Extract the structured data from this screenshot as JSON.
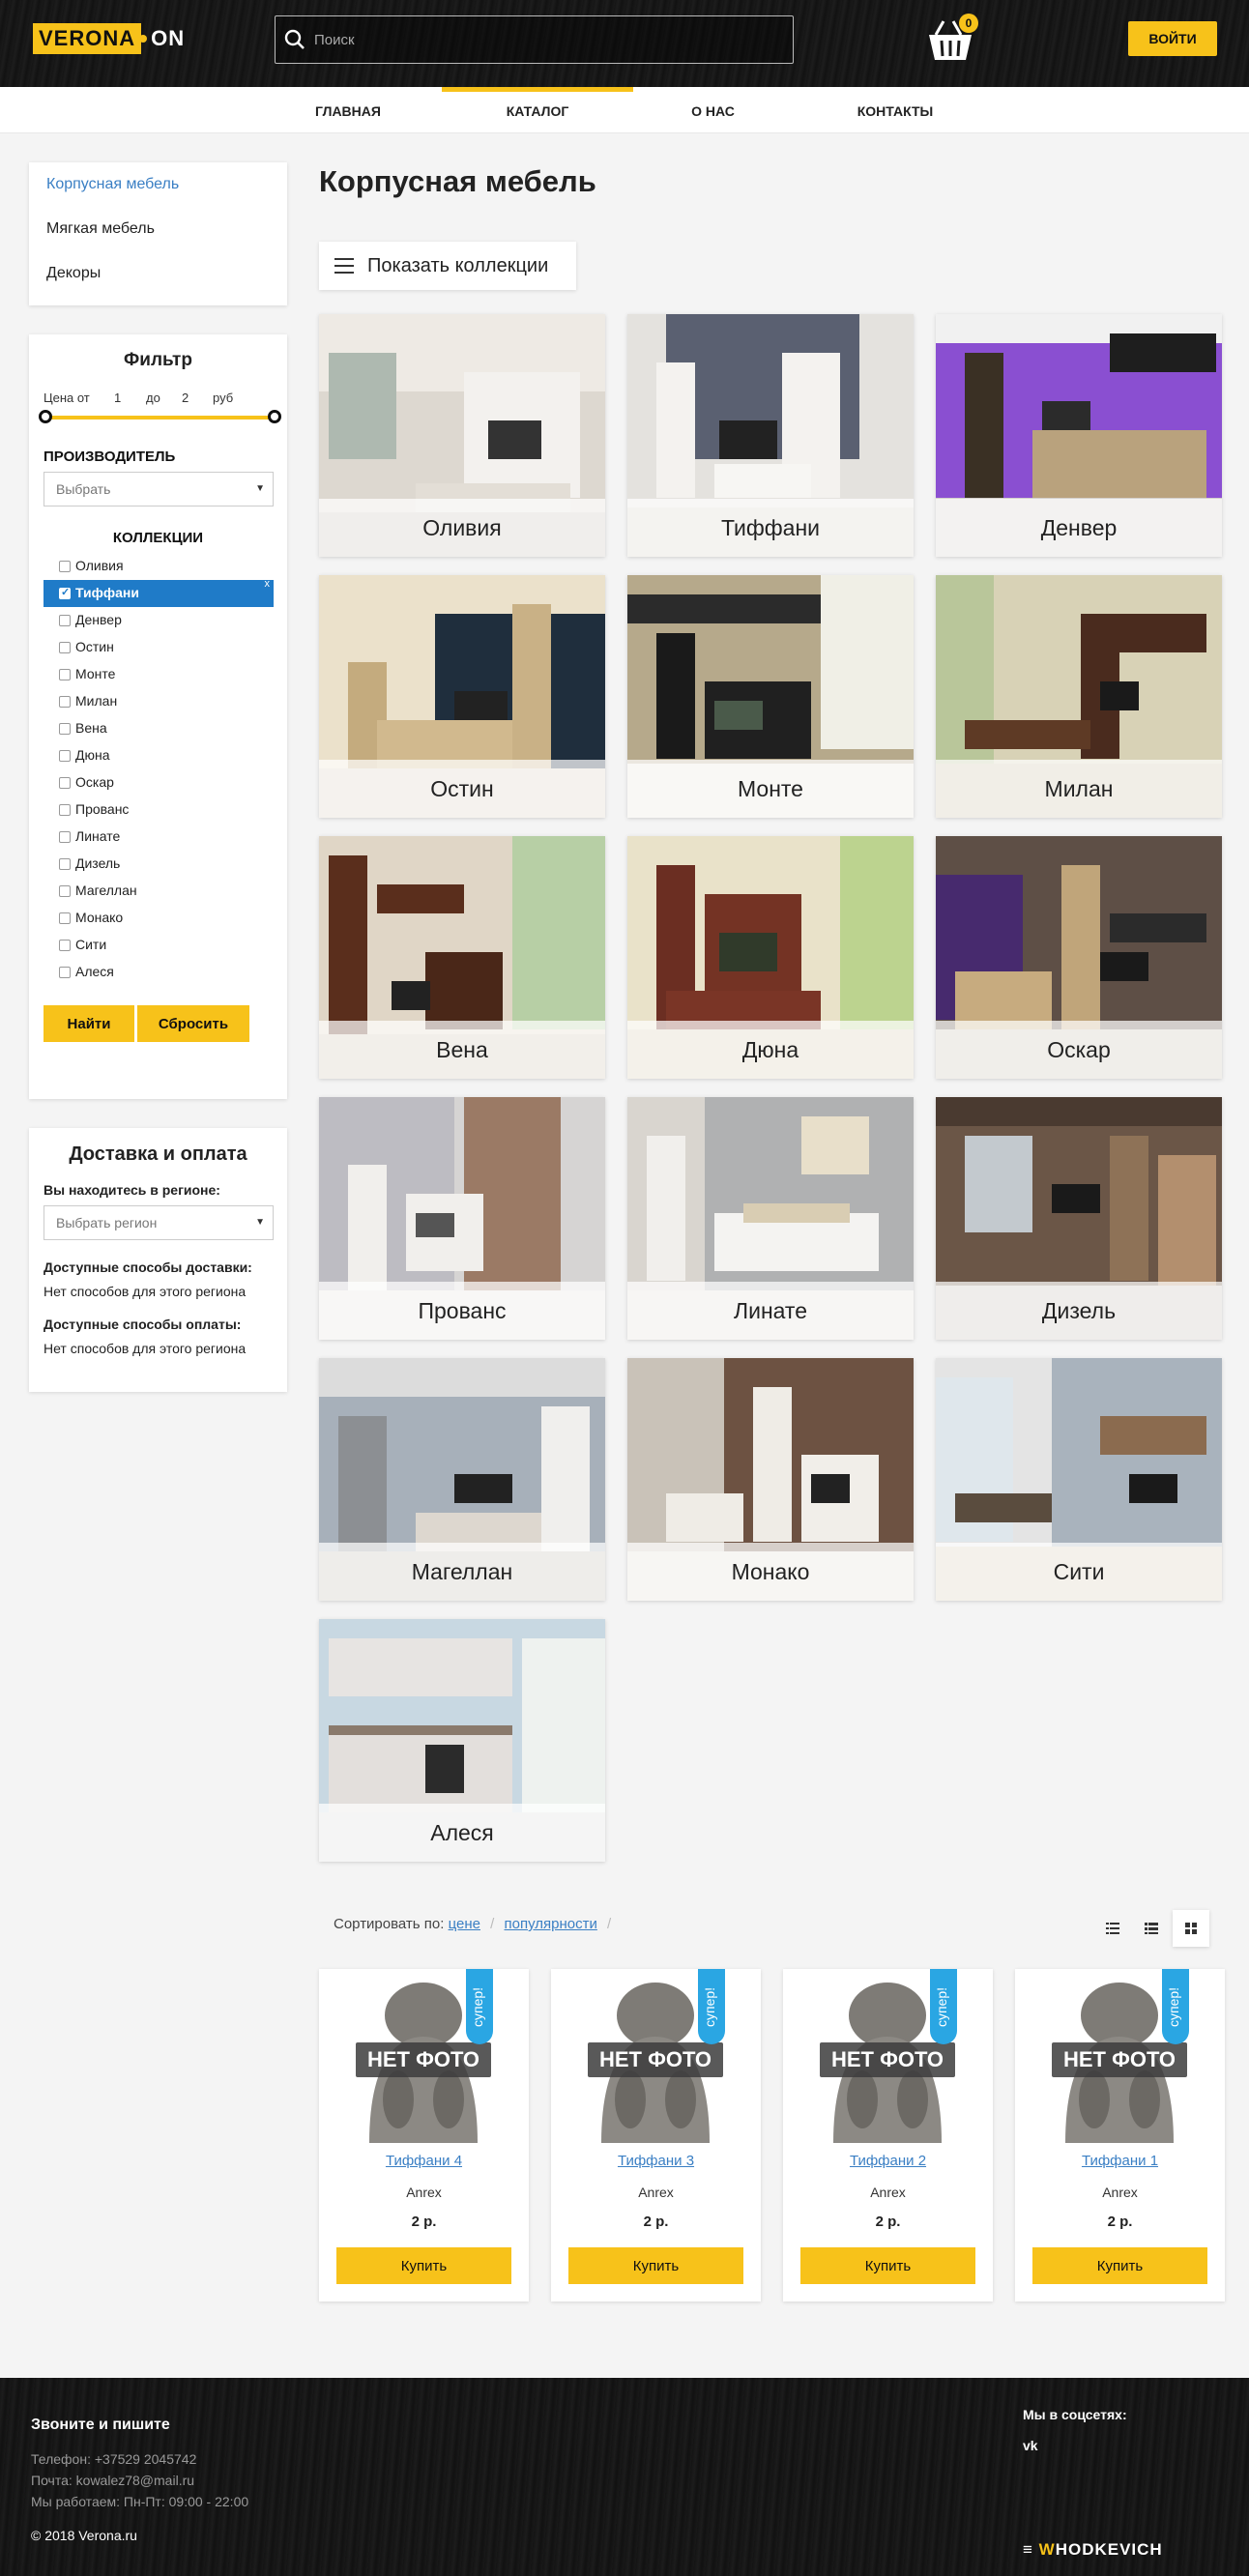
{
  "header": {
    "logo_left": "VERONA",
    "logo_right": "ON",
    "search_placeholder": "Поиск",
    "cart_count": "0",
    "login_label": "ВОЙТИ"
  },
  "nav": [
    {
      "label": "ГЛАВНАЯ"
    },
    {
      "label": "КАТАЛОГ",
      "active": true
    },
    {
      "label": "О НАС"
    },
    {
      "label": "КОНТАКТЫ"
    }
  ],
  "categories": [
    {
      "label": "Корпусная мебель",
      "active": true
    },
    {
      "label": "Мягкая мебель"
    },
    {
      "label": "Декоры"
    }
  ],
  "filter": {
    "title": "Фильтр",
    "price_from_label": "Цена от",
    "price_from": "1",
    "price_to_label": "до",
    "price_to": "2",
    "currency": "руб",
    "manufacturer_label": "ПРОИЗВОДИТЕЛЬ",
    "manufacturer_value": "Выбрать",
    "collections_label": "КОЛЛЕКЦИИ",
    "collections": [
      "Оливия",
      "Тиффани",
      "Денвер",
      "Остин",
      "Монте",
      "Милан",
      "Вена",
      "Дюна",
      "Оскар",
      "Прованс",
      "Линате",
      "Дизель",
      "Магеллан",
      "Монако",
      "Сити",
      "Алеся"
    ],
    "selected_collection": "Тиффани",
    "remove_label": "x",
    "find_label": "Найти",
    "reset_label": "Сбросить"
  },
  "delivery": {
    "title": "Доставка и оплата",
    "region_label": "Вы находитесь в регионе:",
    "region_placeholder": "Выбрать регион",
    "delivery_methods_label": "Доступные способы доставки:",
    "delivery_methods_value": "Нет способов для этого региона",
    "payment_methods_label": "Доступные способы оплаты:",
    "payment_methods_value": "Нет способов для этого региона"
  },
  "main": {
    "title": "Корпусная мебель",
    "show_collections_label": "Показать коллекции",
    "collections": [
      "Оливия",
      "Тиффани",
      "Денвер",
      "Остин",
      "Монте",
      "Милан",
      "Вена",
      "Дюна",
      "Оскар",
      "Прованс",
      "Линате",
      "Дизель",
      "Магеллан",
      "Монако",
      "Сити",
      "Алеся"
    ]
  },
  "sort": {
    "label": "Сортировать по:",
    "by_price": "цене",
    "by_popularity": "популярности",
    "separator": "/"
  },
  "products": [
    {
      "name": "Тиффани 4",
      "brand": "Anrex",
      "price": "2 р.",
      "ribbon": "супер!",
      "no_photo": "НЕТ ФОТО",
      "buy": "Купить"
    },
    {
      "name": "Тиффани 3",
      "brand": "Anrex",
      "price": "2 р.",
      "ribbon": "супер!",
      "no_photo": "НЕТ ФОТО",
      "buy": "Купить"
    },
    {
      "name": "Тиффани 2",
      "brand": "Anrex",
      "price": "2 р.",
      "ribbon": "супер!",
      "no_photo": "НЕТ ФОТО",
      "buy": "Купить"
    },
    {
      "name": "Тиффани 1",
      "brand": "Anrex",
      "price": "2 р.",
      "ribbon": "супер!",
      "no_photo": "НЕТ ФОТО",
      "buy": "Купить"
    }
  ],
  "footer": {
    "heading": "Звоните и пишите",
    "phone": "Телефон: +37529 2045742",
    "email": "Почта: kowalez78@mail.ru",
    "hours": "Мы работаем: Пн-Пт: 09:00 - 22:00",
    "copyright": "© 2018 Verona.ru",
    "social_label": "Мы в соцсетях:",
    "vk": "vk",
    "developer_w": "W",
    "developer_rest": "HODKEVICH"
  },
  "colors": {
    "accent": "#f7c21a",
    "link": "#3a7fc4",
    "selected": "#1f7bc8",
    "ribbon": "#2aa6e3"
  }
}
